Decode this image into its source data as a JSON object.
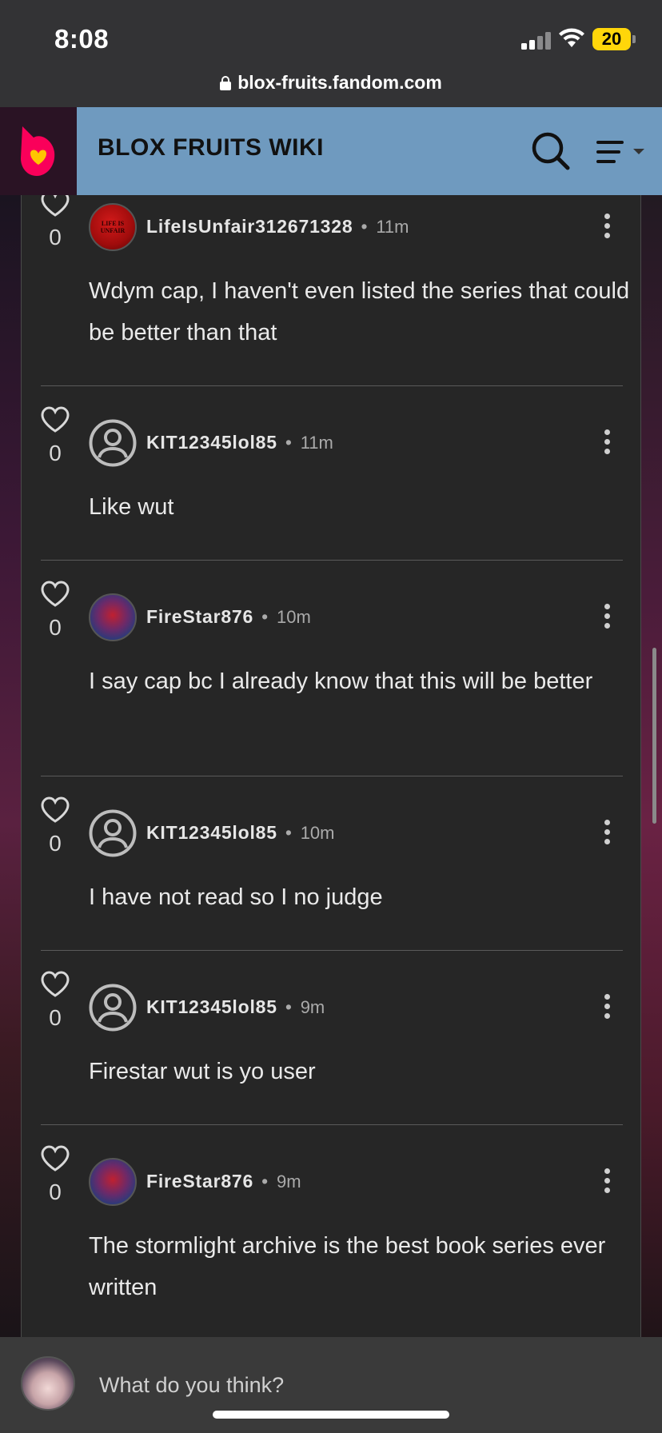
{
  "status_bar": {
    "time": "8:08",
    "battery": "20"
  },
  "browser": {
    "url": "blox-fruits.fandom.com"
  },
  "header": {
    "title": "BLOX FRUITS WIKI"
  },
  "comments": [
    {
      "user": "LifeIsUnfair312671328",
      "time": "11m",
      "likes": "0",
      "avatar": "lifeisunfair",
      "avatar_text": "LIFE IS UNFAIR",
      "text": "Wdym cap, I haven't even listed the series that could be better than that"
    },
    {
      "user": "KIT12345lol85",
      "time": "11m",
      "likes": "0",
      "avatar": "default",
      "text": "Like wut"
    },
    {
      "user": "FireStar876",
      "time": "10m",
      "likes": "0",
      "avatar": "firestar",
      "text": "I say cap bc I already know that this will be better"
    },
    {
      "user": "KIT12345lol85",
      "time": "10m",
      "likes": "0",
      "avatar": "default",
      "text": "I have not read so I no judge"
    },
    {
      "user": "KIT12345lol85",
      "time": "9m",
      "likes": "0",
      "avatar": "default",
      "text": "Firestar wut is yo user"
    },
    {
      "user": "FireStar876",
      "time": "9m",
      "likes": "0",
      "avatar": "firestar",
      "text": "The stormlight archive is the best book series ever written"
    }
  ],
  "composer": {
    "placeholder": "What do you think?"
  },
  "colors": {
    "header_bg": "#6f9abf",
    "panel_bg": "#262626",
    "fandom_red": "#fa005a",
    "fandom_yellow": "#ffc500"
  },
  "icons": {
    "like": "heart-outline-icon",
    "more": "vertical-ellipsis-icon",
    "search": "search-icon",
    "menu": "hamburger-menu-icon",
    "default_avatar": "user-circle-icon"
  }
}
